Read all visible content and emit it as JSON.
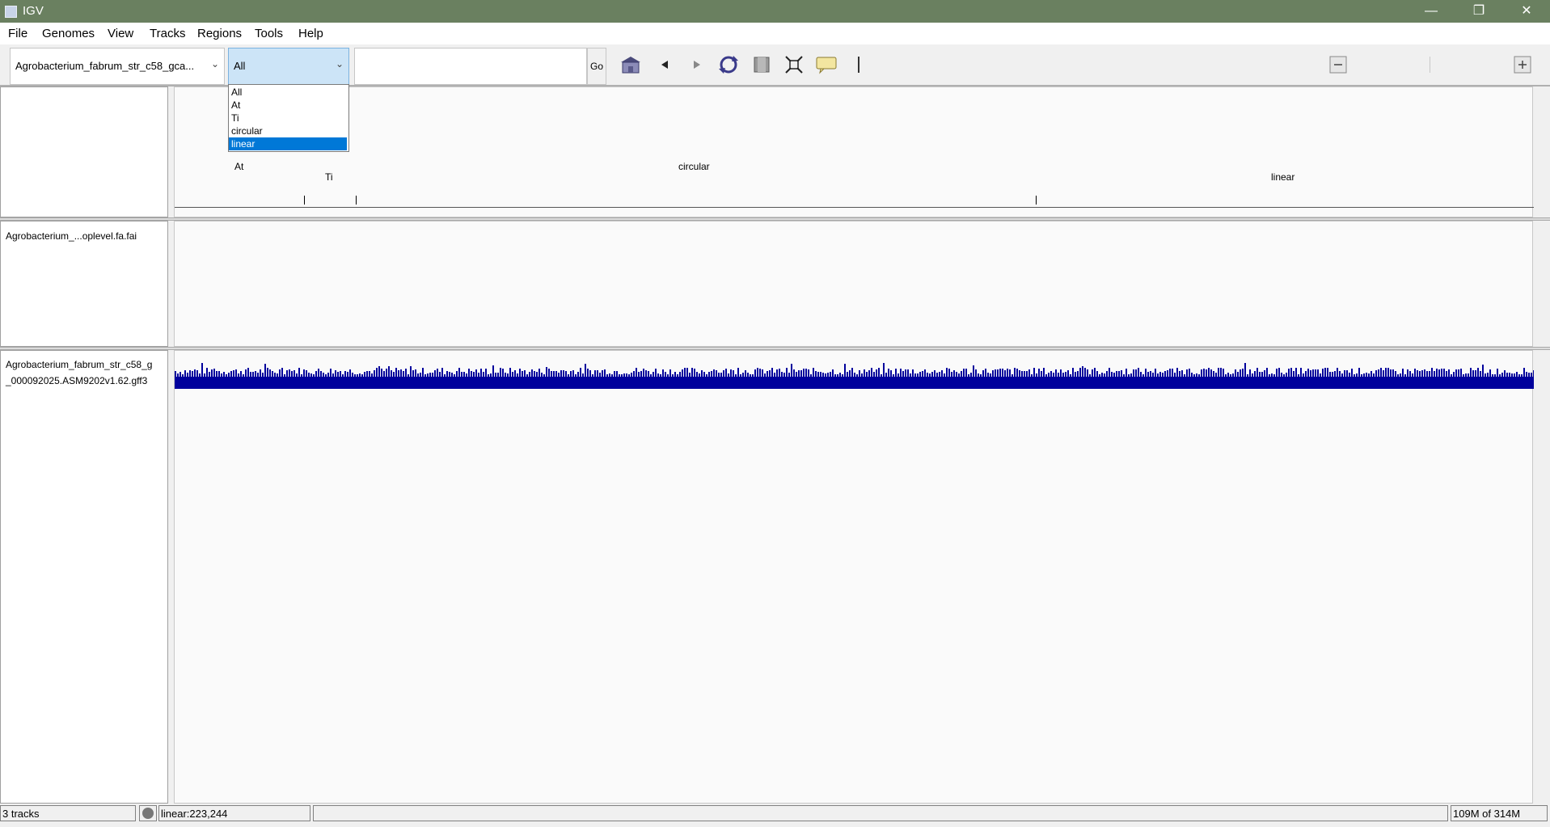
{
  "window": {
    "title": "IGV",
    "minimize": "—",
    "restore": "❐",
    "close": "✕"
  },
  "menu": [
    "File",
    "Genomes",
    "View",
    "Tracks",
    "Regions",
    "Tools",
    "Help"
  ],
  "toolbar": {
    "genome": "Agrobacterium_fabrum_str_c58_gca...",
    "chromosome": "All",
    "locus_value": "",
    "go_label": "Go"
  },
  "chrom_dropdown": {
    "options": [
      "All",
      "At",
      "Ti",
      "circular",
      "linear"
    ],
    "selected": "linear"
  },
  "ideogram": {
    "labels": [
      "At",
      "Ti",
      "circular",
      "linear"
    ]
  },
  "tracks": [
    {
      "name": "Agrobacterium_...oplevel.fa.fai"
    },
    {
      "name_line1": "Agrobacterium_fabrum_str_c58_g",
      "name_line2": "_000092025.ASM9202v1.62.gff3"
    }
  ],
  "status": {
    "track_count": "3 tracks",
    "position": "linear:223,244",
    "message": "",
    "memory": "109M of 314M"
  },
  "colors": {
    "feature": "#00009c",
    "selection": "#0078d7",
    "titlebar": "#6a8060"
  },
  "icons": [
    "home-icon",
    "back-icon",
    "forward-icon",
    "refresh-icon",
    "roi-icon",
    "resize-icon",
    "popup-info-icon",
    "ruler-icon",
    "zoom-out-icon",
    "zoom-in-icon"
  ]
}
